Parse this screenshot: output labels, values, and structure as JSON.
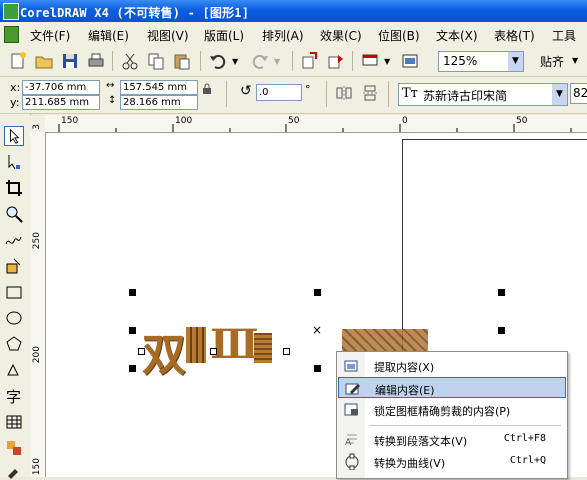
{
  "window": {
    "title": "CorelDRAW X4 (不可转售) - [图形1]"
  },
  "menu": [
    {
      "label": "文件(F)"
    },
    {
      "label": "编辑(E)"
    },
    {
      "label": "视图(V)"
    },
    {
      "label": "版面(L)"
    },
    {
      "label": "排列(A)"
    },
    {
      "label": "效果(C)"
    },
    {
      "label": "位图(B)"
    },
    {
      "label": "文本(X)"
    },
    {
      "label": "表格(T)"
    },
    {
      "label": "工具"
    }
  ],
  "toolbar": {
    "zoom": "125%",
    "snap_label": "贴齐"
  },
  "propbar": {
    "x_label": "x:",
    "y_label": "y:",
    "x": "-37.706 mm",
    "y": "211.685 mm",
    "width": "157.545 mm",
    "height": "28.166 mm",
    "rotation": ".0",
    "degree": "°",
    "font_name": "苏新诗古印宋简",
    "font_size": "82"
  },
  "ruler_top": [
    "150",
    "100",
    "50",
    "0",
    "50"
  ],
  "ruler_left": [
    "3",
    "250",
    "200",
    "150"
  ],
  "canvas": {
    "artwork_left": "双",
    "artwork_mid": "Ⅲ"
  },
  "toolbox": {
    "text_tool_glyph": "字"
  },
  "context_menu": {
    "items": [
      {
        "label": "提取内容(X)",
        "shortcut": ""
      },
      {
        "label": "编辑内容(E)",
        "shortcut": ""
      },
      {
        "label": "锁定图框精确剪裁的内容(P)",
        "shortcut": ""
      },
      {
        "label": "转换到段落文本(V)",
        "shortcut": "Ctrl+F8"
      },
      {
        "label": "转换为曲线(V)",
        "shortcut": "Ctrl+Q"
      }
    ]
  },
  "colors": {
    "title_bar": "#0a5fe0",
    "highlight": "#c1d2ee",
    "artwork": "#a86b25"
  }
}
